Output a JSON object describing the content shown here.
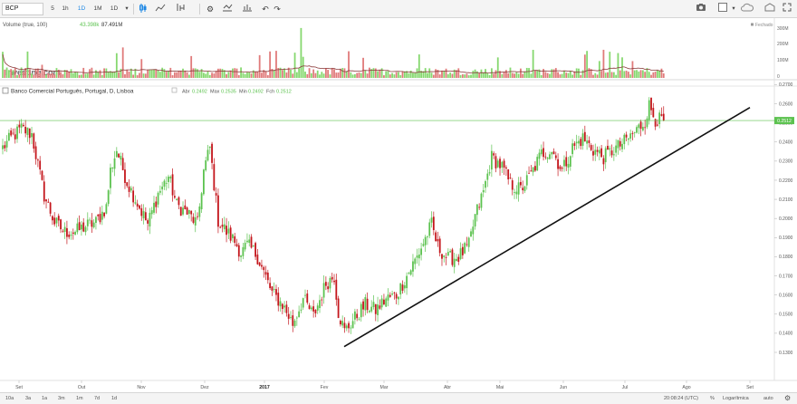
{
  "toolbar": {
    "symbol": "BCP",
    "intervals": [
      "5",
      "1h",
      "1D",
      "1M",
      "1D"
    ],
    "selected_interval": "1D"
  },
  "volume_panel": {
    "title": "Volume (true, 100)",
    "value1": "43.398k",
    "value2": "87.491M",
    "logo": "Investing.com",
    "closed_label": "Fechado",
    "scale": [
      "300M",
      "200M",
      "100M",
      "0"
    ]
  },
  "price_panel": {
    "title": "Banco Comercial Português, Portugal, D, Lisboa",
    "ohlc": [
      {
        "label": "Abr",
        "value": "0.2492"
      },
      {
        "label": "Max",
        "value": "0.2535"
      },
      {
        "label": "Min",
        "value": "0.2492"
      },
      {
        "label": "Fch",
        "value": "0.2512"
      }
    ],
    "last_price": "0.2512"
  },
  "colors": {
    "up": "#5cc24f",
    "down": "#c4161c",
    "vol_up": "#86d86f",
    "vol_down": "#e07b7b",
    "last_line": "#5cc24f"
  },
  "bottom": {
    "ranges": [
      "10a",
      "3a",
      "1a",
      "3m",
      "1m",
      "7d",
      "1d"
    ],
    "time": "20:08:24 (UTC)",
    "percent": "%",
    "log": "Logarítmica",
    "auto": "auto"
  },
  "chart_data": {
    "type": "candlestick",
    "title": "Banco Comercial Português, Portugal, D, Lisboa",
    "x_ticks": [
      "Set",
      "Out",
      "Nov",
      "Dez",
      "2017",
      "Fev",
      "Mar",
      "Abr",
      "Mai",
      "Jun",
      "Jul",
      "Ago",
      "Set"
    ],
    "y_ticks": [
      0.13,
      0.14,
      0.15,
      0.16,
      0.17,
      0.18,
      0.19,
      0.2,
      0.21,
      0.22,
      0.23,
      0.24,
      0.25,
      0.26,
      0.27
    ],
    "ylim": [
      0.1255,
      0.2735
    ],
    "last_price": 0.2512,
    "trendline": [
      {
        "date": "Fev",
        "price": 0.133
      },
      {
        "date": "Set",
        "price": 0.258
      }
    ],
    "anchors": [
      [
        0,
        0.237
      ],
      [
        4,
        0.242
      ],
      [
        9,
        0.247
      ],
      [
        14,
        0.244
      ],
      [
        20,
        0.212
      ],
      [
        25,
        0.198
      ],
      [
        30,
        0.193
      ],
      [
        35,
        0.193
      ],
      [
        40,
        0.196
      ],
      [
        45,
        0.198
      ],
      [
        50,
        0.206
      ],
      [
        52,
        0.225
      ],
      [
        55,
        0.236
      ],
      [
        60,
        0.219
      ],
      [
        65,
        0.208
      ],
      [
        70,
        0.197
      ],
      [
        75,
        0.213
      ],
      [
        80,
        0.222
      ],
      [
        84,
        0.207
      ],
      [
        90,
        0.202
      ],
      [
        94,
        0.197
      ],
      [
        97,
        0.225
      ],
      [
        100,
        0.237
      ],
      [
        104,
        0.199
      ],
      [
        108,
        0.193
      ],
      [
        112,
        0.188
      ],
      [
        115,
        0.182
      ],
      [
        118,
        0.186
      ],
      [
        121,
        0.183
      ],
      [
        123,
        0.18
      ],
      [
        130,
        0.161
      ],
      [
        135,
        0.155
      ],
      [
        140,
        0.145
      ],
      [
        145,
        0.158
      ],
      [
        150,
        0.149
      ],
      [
        156,
        0.166
      ],
      [
        160,
        0.17
      ],
      [
        162,
        0.151
      ],
      [
        165,
        0.141
      ],
      [
        170,
        0.148
      ],
      [
        175,
        0.155
      ],
      [
        180,
        0.152
      ],
      [
        185,
        0.158
      ],
      [
        190,
        0.16
      ],
      [
        195,
        0.17
      ],
      [
        200,
        0.18
      ],
      [
        205,
        0.192
      ],
      [
        207,
        0.197
      ],
      [
        210,
        0.185
      ],
      [
        215,
        0.179
      ],
      [
        220,
        0.18
      ],
      [
        225,
        0.186
      ],
      [
        228,
        0.201
      ],
      [
        232,
        0.214
      ],
      [
        236,
        0.232
      ],
      [
        238,
        0.23
      ],
      [
        241,
        0.227
      ],
      [
        245,
        0.218
      ],
      [
        250,
        0.215
      ],
      [
        255,
        0.223
      ],
      [
        260,
        0.234
      ],
      [
        265,
        0.236
      ],
      [
        270,
        0.225
      ],
      [
        275,
        0.237
      ],
      [
        280,
        0.242
      ],
      [
        285,
        0.236
      ],
      [
        290,
        0.232
      ],
      [
        295,
        0.236
      ],
      [
        300,
        0.24
      ],
      [
        305,
        0.245
      ],
      [
        310,
        0.251
      ],
      [
        312,
        0.259
      ],
      [
        315,
        0.252
      ],
      [
        319,
        0.251
      ]
    ],
    "volume_ylim": [
      0,
      300
    ],
    "volume_unit": "M"
  }
}
